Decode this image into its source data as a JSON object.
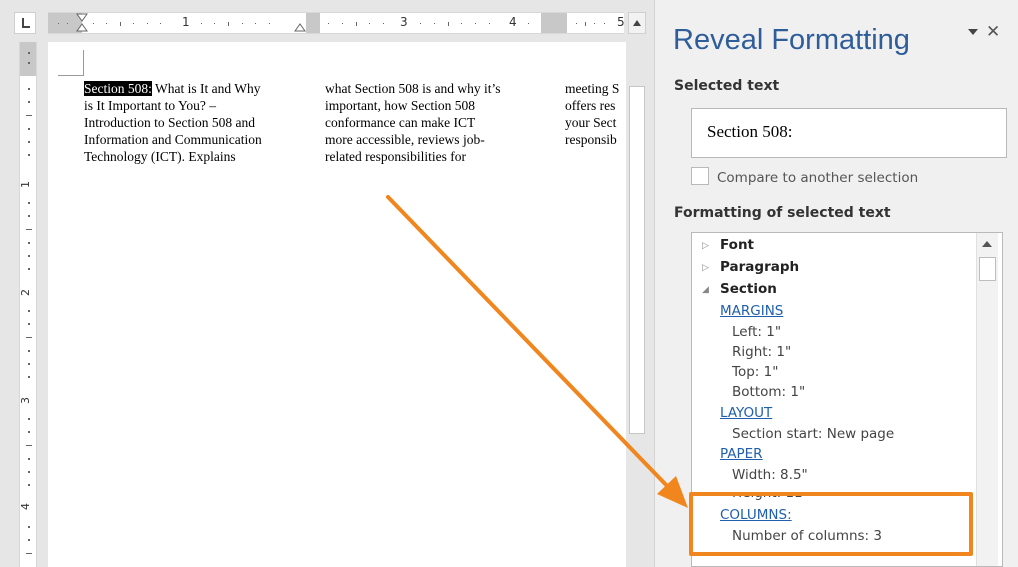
{
  "ruler": {
    "numbers": [
      "1",
      "3",
      "4",
      "5"
    ],
    "vertical_numbers": [
      "1",
      "2",
      "3",
      "4"
    ]
  },
  "document": {
    "selected_text": "Section 508:",
    "col1_lines": [
      " What is It and Why",
      "is It Important to You? –",
      "Introduction to Section 508 and",
      "Information and Communication",
      "Technology (ICT). Explains"
    ],
    "col2_lines": [
      "what Section 508 is and why it’s",
      "important, how Section 508",
      "conformance can make ICT",
      "more accessible, reviews job-",
      "related responsibilities for"
    ],
    "col3_lines": [
      "meeting S",
      "offers res",
      "your Sect",
      "responsib"
    ]
  },
  "pane": {
    "title": "Reveal Formatting",
    "selected_text_heading": "Selected text",
    "selected_text_value": "Section 508:",
    "compare_label": "Compare to another selection",
    "formatting_heading": "Formatting of selected text",
    "tree": {
      "font_label": "Font",
      "paragraph_label": "Paragraph",
      "section_label": "Section",
      "margins_link": "MARGINS",
      "left": "Left:  1\"",
      "right": "Right:  1\"",
      "top": "Top:  1\"",
      "bottom": "Bottom:  1\"",
      "layout_link": "LAYOUT",
      "section_start": "Section start: New page",
      "paper_link": "PAPER",
      "width": "Width:  8.5\"",
      "height": "Height:  11\"",
      "columns_link": "COLUMNS:",
      "num_columns": "Number of columns: 3"
    }
  },
  "annotation": {
    "color": "#f0861d"
  }
}
